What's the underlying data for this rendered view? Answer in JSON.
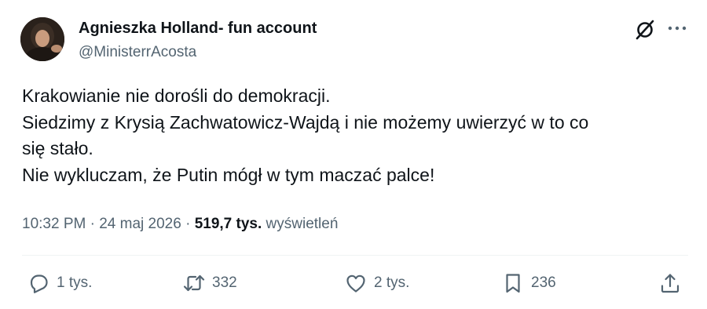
{
  "author": {
    "name": "Agnieszka Holland- fun account",
    "handle": "@MinisterrAcosta"
  },
  "tweet": {
    "lines": [
      "Krakowianie nie dorośli do demokracji.",
      "Siedzimy z Krysią Zachwatowicz-Wajdą i nie możemy uwierzyć w to co",
      "się stało.",
      "Nie wykluczam, że Putin mógł w tym maczać palce!"
    ]
  },
  "meta": {
    "time": "10:32 PM",
    "separator": " · ",
    "date": "24 maj 2026",
    "separator2": " · ",
    "views_count": "519,7 tys.",
    "views_label": "wyświetleń"
  },
  "actions": {
    "replies": "1 tys.",
    "reposts": "332",
    "likes": "2 tys.",
    "bookmarks": "236"
  },
  "icons": {
    "grok": "grok-icon",
    "more": "more-icon",
    "reply": "reply-icon",
    "repost": "repost-icon",
    "like": "heart-icon",
    "bookmark": "bookmark-icon",
    "share": "share-icon"
  },
  "colors": {
    "text": "#0f1419",
    "secondary": "#536471",
    "divider": "#eff3f4"
  }
}
